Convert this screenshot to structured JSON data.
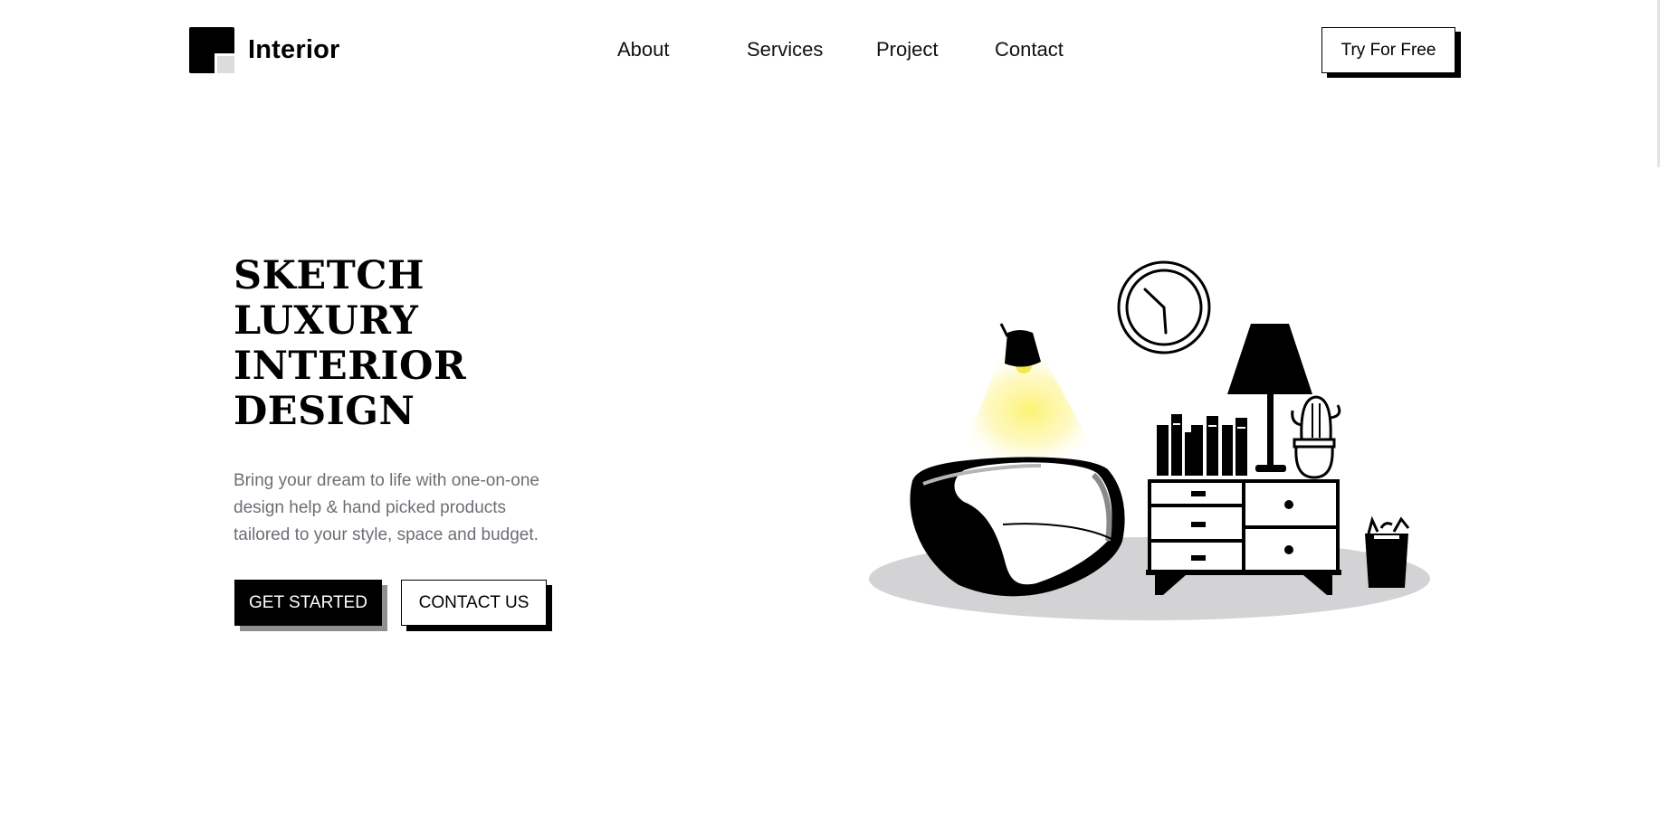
{
  "header": {
    "logo_text": "Interior",
    "nav": [
      "About",
      "Services",
      "Project",
      "Contact"
    ],
    "cta_label": "Try For Free"
  },
  "hero": {
    "title_lines": [
      "SKETCH",
      "LUXURY",
      "INTERIOR",
      "DESIGN"
    ],
    "description_lines": [
      "Bring your dream to life with one-on-one",
      "design help & hand picked products",
      "tailored to your style, space and budget."
    ],
    "primary_button": "GET STARTED",
    "secondary_button": "CONTACT US"
  },
  "illustration": {
    "objects": [
      "wall-clock",
      "pendant-lamp",
      "armchair",
      "books",
      "table-lamp",
      "cactus-pot",
      "dresser",
      "trash-bin",
      "floor-rug"
    ]
  },
  "colors": {
    "accent_light": "#fdf26a",
    "text_muted": "#6b6f75",
    "rug": "#d3d3d5",
    "primary": "#000000"
  }
}
